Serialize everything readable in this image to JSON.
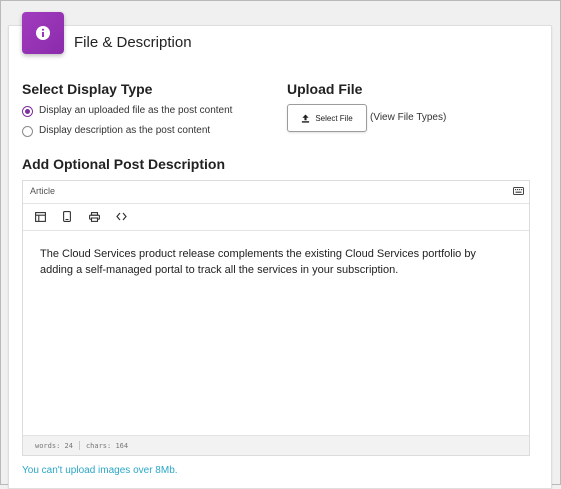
{
  "header": {
    "title": "File & Description",
    "badge_icon": "info-icon",
    "badge_color": "#9a34b8"
  },
  "display_type": {
    "heading": "Select Display Type",
    "options": [
      {
        "label": "Display an uploaded file as the post content",
        "checked": true
      },
      {
        "label": "Display description as the post content",
        "checked": false
      }
    ]
  },
  "upload": {
    "heading": "Upload File",
    "button_label": "Select File",
    "button_icon": "upload-icon",
    "view_types_label": "(View File Types)"
  },
  "description": {
    "heading": "Add Optional Post Description",
    "editor_style": "Article",
    "toolbar": [
      {
        "name": "template-icon"
      },
      {
        "name": "mobile-preview-icon"
      },
      {
        "name": "print-icon"
      },
      {
        "name": "source-code-icon"
      }
    ],
    "body_text": "The Cloud Services product release complements the existing Cloud Services portfolio by adding a self-managed portal to track all the services in your subscription.",
    "words_label": "words: 24",
    "chars_label": "chars: 164"
  },
  "upload_note": "You can't upload images over 8Mb.",
  "colors": {
    "accent": "#7d2f9c",
    "note": "#2aa7c7"
  }
}
